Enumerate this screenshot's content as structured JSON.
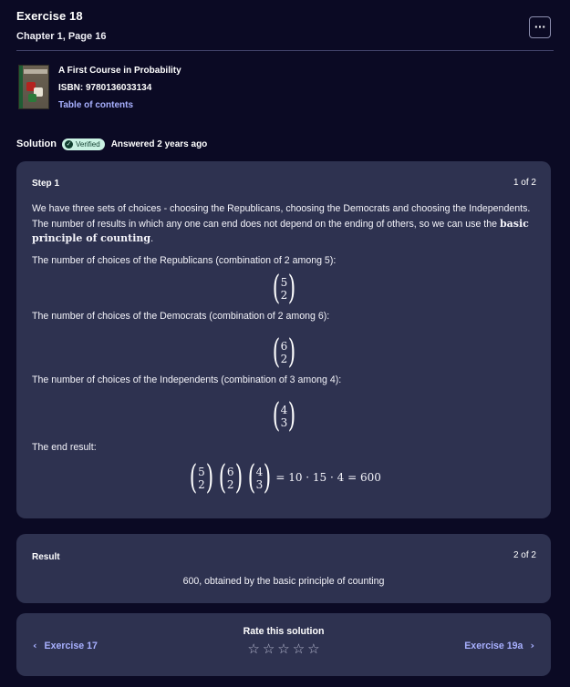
{
  "header": {
    "title": "Exercise 18",
    "subtitle": "Chapter 1, Page 16",
    "more_label": "···"
  },
  "book": {
    "title": "A First Course in Probability",
    "isbn": "ISBN: 9780136033134",
    "toc_link": "Table of contents",
    "cover_icon": "book-cover-image"
  },
  "solution": {
    "label": "Solution",
    "verified_label": "Verified",
    "verified_icon": "check-circle-icon",
    "answered": "Answered 2 years ago"
  },
  "step": {
    "title": "Step 1",
    "count": "1 of 2",
    "intro": "We have three sets of choices - choosing the Republicans, choosing the Democrats and choosing the Independents. The number of results in which any one can end does not depend on the ending of others, so we can use the ",
    "intro_bold": "basic principle of counting",
    "intro_end": ".",
    "rep_text": "The number of choices of the Republicans (combination of 2 among 5):",
    "rep_binom": {
      "n": "5",
      "k": "2"
    },
    "dem_text": "The number of choices of the Democrats (combination of 2 among 6):",
    "dem_binom": {
      "n": "6",
      "k": "2"
    },
    "ind_text": "The number of choices of the Independents (combination of 3 among 4):",
    "ind_binom": {
      "n": "4",
      "k": "3"
    },
    "end_text": "The end result:",
    "end_eq": "= 10 · 15 · 4 = 600"
  },
  "result": {
    "title": "Result",
    "count": "2 of 2",
    "text": "600, obtained by the basic principle of counting"
  },
  "nav": {
    "prev": "Exercise 17",
    "next": "Exercise 19a",
    "rate_title": "Rate this solution",
    "stars": 5,
    "star_glyph": "☆",
    "prev_icon": "chevron-left-icon",
    "next_icon": "chevron-right-icon"
  },
  "colors": {
    "background": "#0b0a24",
    "card": "#2e3250",
    "link": "#a8b0ff",
    "verified_bg": "#c9f2e3"
  }
}
